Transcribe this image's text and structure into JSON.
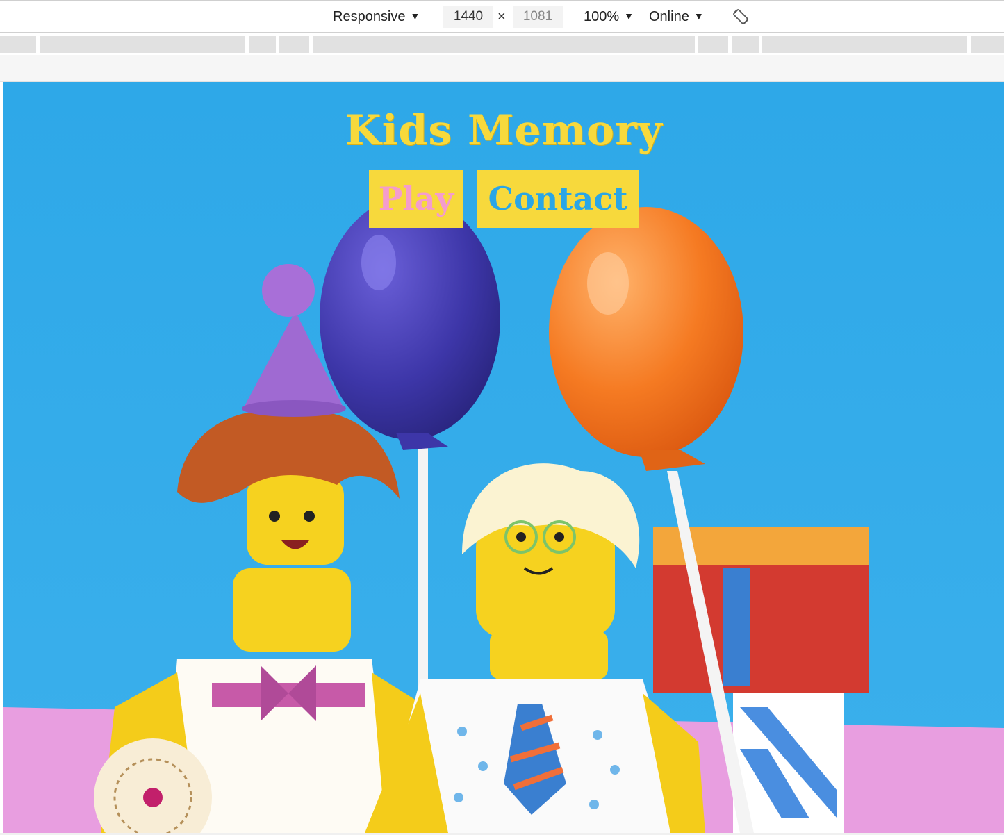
{
  "devtools": {
    "device": "Responsive",
    "width": "1440",
    "times": "×",
    "height": "1081",
    "zoom": "100%",
    "network": "Online"
  },
  "site": {
    "title": "Kids Memory",
    "nav": {
      "play": "Play",
      "contact": "Contact"
    }
  },
  "colors": {
    "sky": "#2aa6e6",
    "yellow": "#f7d93c",
    "pink": "#f49ccd"
  }
}
